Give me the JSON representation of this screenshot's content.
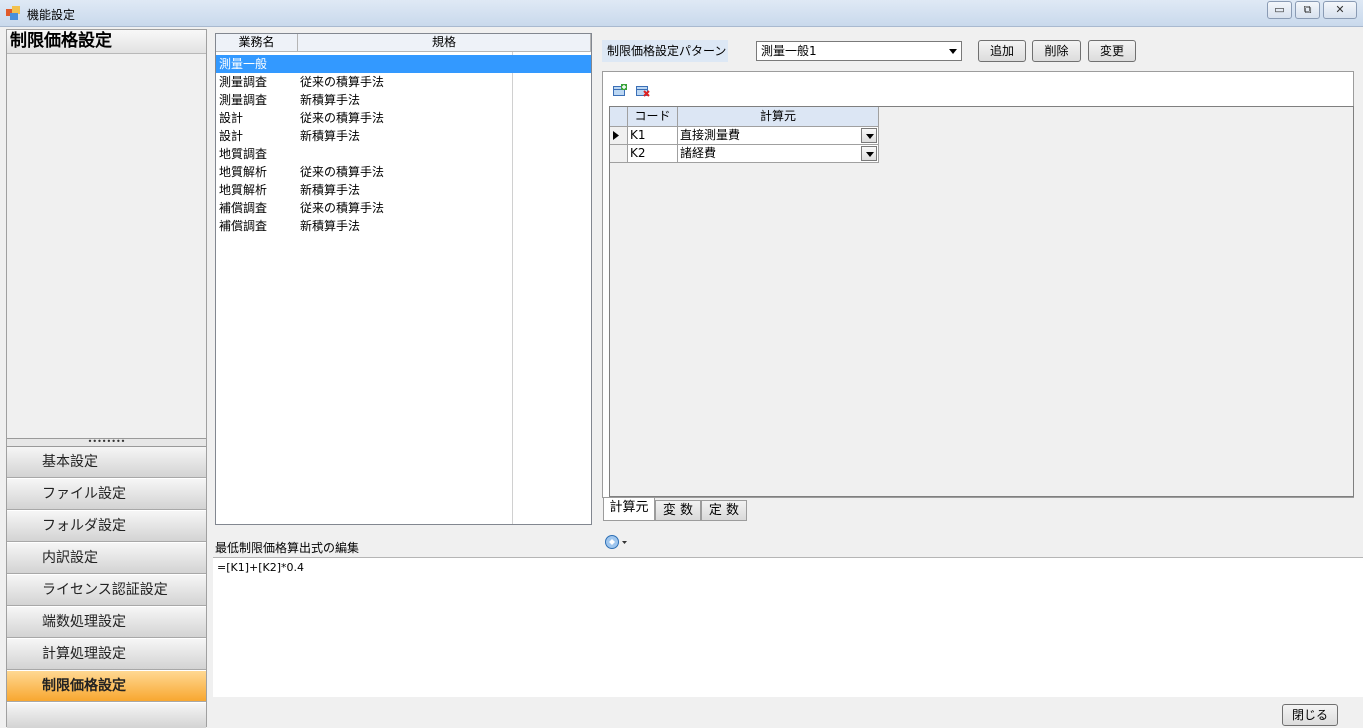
{
  "window": {
    "title": "機能設定",
    "minimize_label": "▭",
    "restore_label": "⧉",
    "close_label": "✕"
  },
  "nav": {
    "header": "制限価格設定",
    "splitter": "••••••••",
    "items": [
      {
        "label": "基本設定"
      },
      {
        "label": "ファイル設定"
      },
      {
        "label": "フォルダ設定"
      },
      {
        "label": "内訳設定"
      },
      {
        "label": "ライセンス認証設定"
      },
      {
        "label": "端数処理設定"
      },
      {
        "label": "計算処理設定"
      },
      {
        "label": "制限価格設定",
        "active": true
      }
    ]
  },
  "list": {
    "headers": [
      "業務名",
      "規格"
    ],
    "rows": [
      {
        "name": "測量一般",
        "spec": "",
        "selected": true
      },
      {
        "name": "測量調査",
        "spec": "従来の積算手法"
      },
      {
        "name": "測量調査",
        "spec": "新積算手法"
      },
      {
        "name": "設計",
        "spec": "従来の積算手法"
      },
      {
        "name": "設計",
        "spec": "新積算手法"
      },
      {
        "name": "地質調査",
        "spec": ""
      },
      {
        "name": "地質解析",
        "spec": "従来の積算手法"
      },
      {
        "name": "地質解析",
        "spec": "新積算手法"
      },
      {
        "name": "補償調査",
        "spec": "従来の積算手法"
      },
      {
        "name": "補償調査",
        "spec": "新積算手法"
      }
    ]
  },
  "pattern": {
    "label": "制限価格設定パターン",
    "selected": "測量一般1",
    "add": "追加",
    "delete": "削除",
    "change": "変更"
  },
  "grid": {
    "headers": [
      "コード",
      "計算元"
    ],
    "rows": [
      {
        "code": "K1",
        "source": "直接測量費",
        "current": true
      },
      {
        "code": "K2",
        "source": "諸経費"
      }
    ]
  },
  "tabs": [
    "計算元",
    "変 数",
    "定 数"
  ],
  "formula": {
    "label": "最低制限価格算出式の編集",
    "value": "=[K1]+[K2]*0.4"
  },
  "footer": {
    "close": "閉じる"
  },
  "icons": {
    "app": "app-window-icon",
    "add_row": "add-row-icon",
    "delete_row": "delete-row-icon",
    "insert": "insert-field-icon"
  },
  "colors": {
    "selection": "#3399ff",
    "nav_active": "#f8a730",
    "header": "#dce6f4"
  }
}
